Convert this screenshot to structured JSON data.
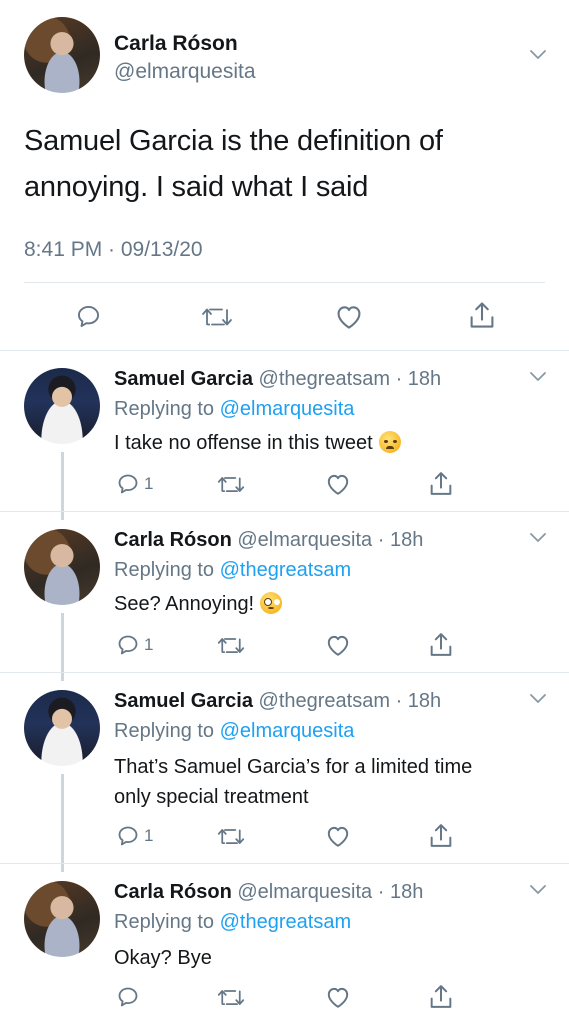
{
  "main_tweet": {
    "author_name": "Carla Róson",
    "author_handle": "@elmarquesita",
    "text_line1": "Samuel Garcia is the definition of",
    "text_line2": "annoying. I said what I said",
    "timestamp": "8:41 PM · 09/13/20"
  },
  "replies": [
    {
      "name": "Samuel Garcia",
      "handle": "@thegreatsam",
      "time": "· 18h",
      "replying_prefix": "Replying to",
      "replying_to": "@elmarquesita",
      "text": "I take no offense in this tweet",
      "emoji": "disappointed-face",
      "reply_count": "1"
    },
    {
      "name": "Carla Róson",
      "handle": "@elmarquesita",
      "time": "· 18h",
      "replying_prefix": "Replying to",
      "replying_to": "@thegreatsam",
      "text": "See? Annoying!",
      "emoji": "face-with-rolling-eyes",
      "reply_count": "1"
    },
    {
      "name": "Samuel Garcia",
      "handle": "@thegreatsam",
      "time": "· 18h",
      "replying_prefix": "Replying to",
      "replying_to": "@elmarquesita",
      "text_line1": "That’s Samuel Garcia’s for a limited time",
      "text_line2": "only special treatment",
      "reply_count": "1"
    },
    {
      "name": "Carla Róson",
      "handle": "@elmarquesita",
      "time": "· 18h",
      "replying_prefix": "Replying to",
      "replying_to": "@thegreatsam",
      "text": "Okay? Bye",
      "reply_count": ""
    }
  ],
  "icons": {
    "reply": "reply-icon",
    "retweet": "retweet-icon",
    "like": "like-icon",
    "share": "share-icon",
    "more": "chevron-down-icon"
  },
  "colors": {
    "link": "#1da1f2",
    "muted": "#657786",
    "text": "#14171a",
    "divider": "#e1e8ed"
  }
}
